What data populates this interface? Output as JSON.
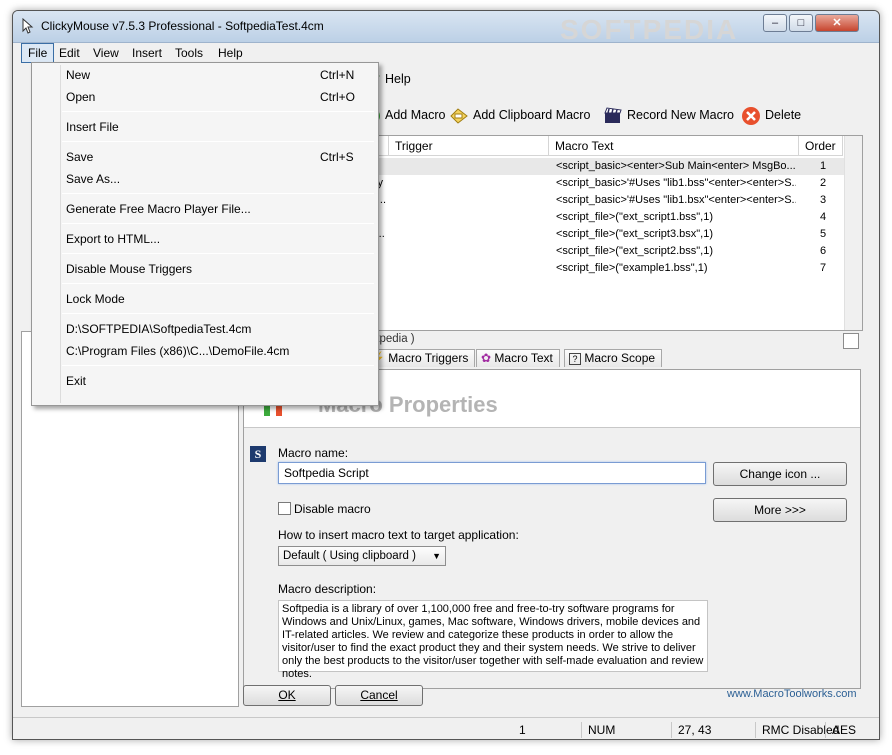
{
  "window": {
    "title": "ClickyMouse v7.5.3 Professional - SoftpediaTest.4cm",
    "minimize_glyph": "–",
    "maximize_glyph": "□",
    "close_glyph": "✕"
  },
  "watermark": "SOFTPEDIA",
  "menubar": [
    "File",
    "Edit",
    "View",
    "Insert",
    "Tools",
    "Help"
  ],
  "file_menu": [
    {
      "label": "New",
      "shortcut": "Ctrl+N"
    },
    {
      "label": "Open",
      "shortcut": "Ctrl+O"
    },
    {
      "label": "Insert File",
      "shortcut": ""
    },
    {
      "label": "Save",
      "shortcut": "Ctrl+S"
    },
    {
      "label": "Save As...",
      "shortcut": ""
    },
    {
      "label": "Generate Free Macro Player File...",
      "shortcut": ""
    },
    {
      "label": "Export to HTML...",
      "shortcut": ""
    },
    {
      "label": "Disable Mouse Triggers",
      "shortcut": ""
    },
    {
      "label": "Lock Mode",
      "shortcut": ""
    },
    {
      "label": "D:\\SOFTPEDIA\\SoftpediaTest.4cm",
      "shortcut": ""
    },
    {
      "label": "C:\\Program Files (x86)\\C...\\DemoFile.4cm",
      "shortcut": ""
    },
    {
      "label": "Exit",
      "shortcut": ""
    }
  ],
  "toolbar": {
    "help": "Help",
    "add_macro": "Add Macro",
    "add_clipboard_macro": "Add Clipboard Macro",
    "record_new_macro": "Record New Macro",
    "delete": "Delete"
  },
  "macro_list": {
    "columns": [
      "Trigger",
      "Macro Text",
      "Order"
    ],
    "rows": [
      {
        "name": "",
        "trigger": "",
        "text": "<script_basic><enter>Sub Main<enter>   MsgBo...",
        "order": "1"
      },
      {
        "name": "rary",
        "trigger": "",
        "text": "<script_basic>'#Uses \"lib1.bss\"<enter><enter>S...",
        "order": "2"
      },
      {
        "name": "rar...",
        "trigger": "",
        "text": "<script_basic>'#Uses \"lib1.bsx\"<enter><enter>S...",
        "order": "3"
      },
      {
        "name": "",
        "trigger": "",
        "text": "<script_file>(\"ext_script1.bss\",1)",
        "order": "4"
      },
      {
        "name": "co...",
        "trigger": "",
        "text": "<script_file>(\"ext_script3.bsx\",1)",
        "order": "5"
      },
      {
        "name": "y",
        "trigger": "",
        "text": "<script_file>(\"ext_script2.bss\",1)",
        "order": "6"
      },
      {
        "name": "",
        "trigger": "",
        "text": "<script_file>(\"example1.bss\",1)",
        "order": "7"
      }
    ]
  },
  "props_header": "Softpedia )",
  "tabs": [
    "Macro Triggers",
    "Macro Text",
    "Macro Scope"
  ],
  "properties": {
    "banner_title": "Macro Properties",
    "name_label": "Macro name:",
    "name_value": "Softpedia Script",
    "change_icon": "Change icon ...",
    "disable_macro": "Disable macro",
    "more": "More >>>",
    "insert_label": "How to insert macro text to target application:",
    "insert_value": "Default ( Using clipboard )",
    "description_label": "Macro description:",
    "description": "Softpedia is a library of over 1,100,000 free and free-to-try software programs for Windows and Unix/Linux, games, Mac software, Windows drivers, mobile devices and IT-related articles. We review and categorize these products in order to allow the visitor/user to find the exact product they and their system needs. We strive to deliver only the best products to the visitor/user together with self-made evaluation and review notes.",
    "s_badge": "S"
  },
  "buttons": {
    "ok": "OK",
    "cancel": "Cancel"
  },
  "website": "www.MacroToolworks.com",
  "status": {
    "count": "1",
    "num": "NUM",
    "pos": "27, 43",
    "rmc": "RMC Disabled",
    "aes": "AES"
  },
  "colors": {
    "accent": "#3a6ea5",
    "link": "#2b5f94",
    "delete": "#e8502d",
    "add": "#3cab3c"
  }
}
